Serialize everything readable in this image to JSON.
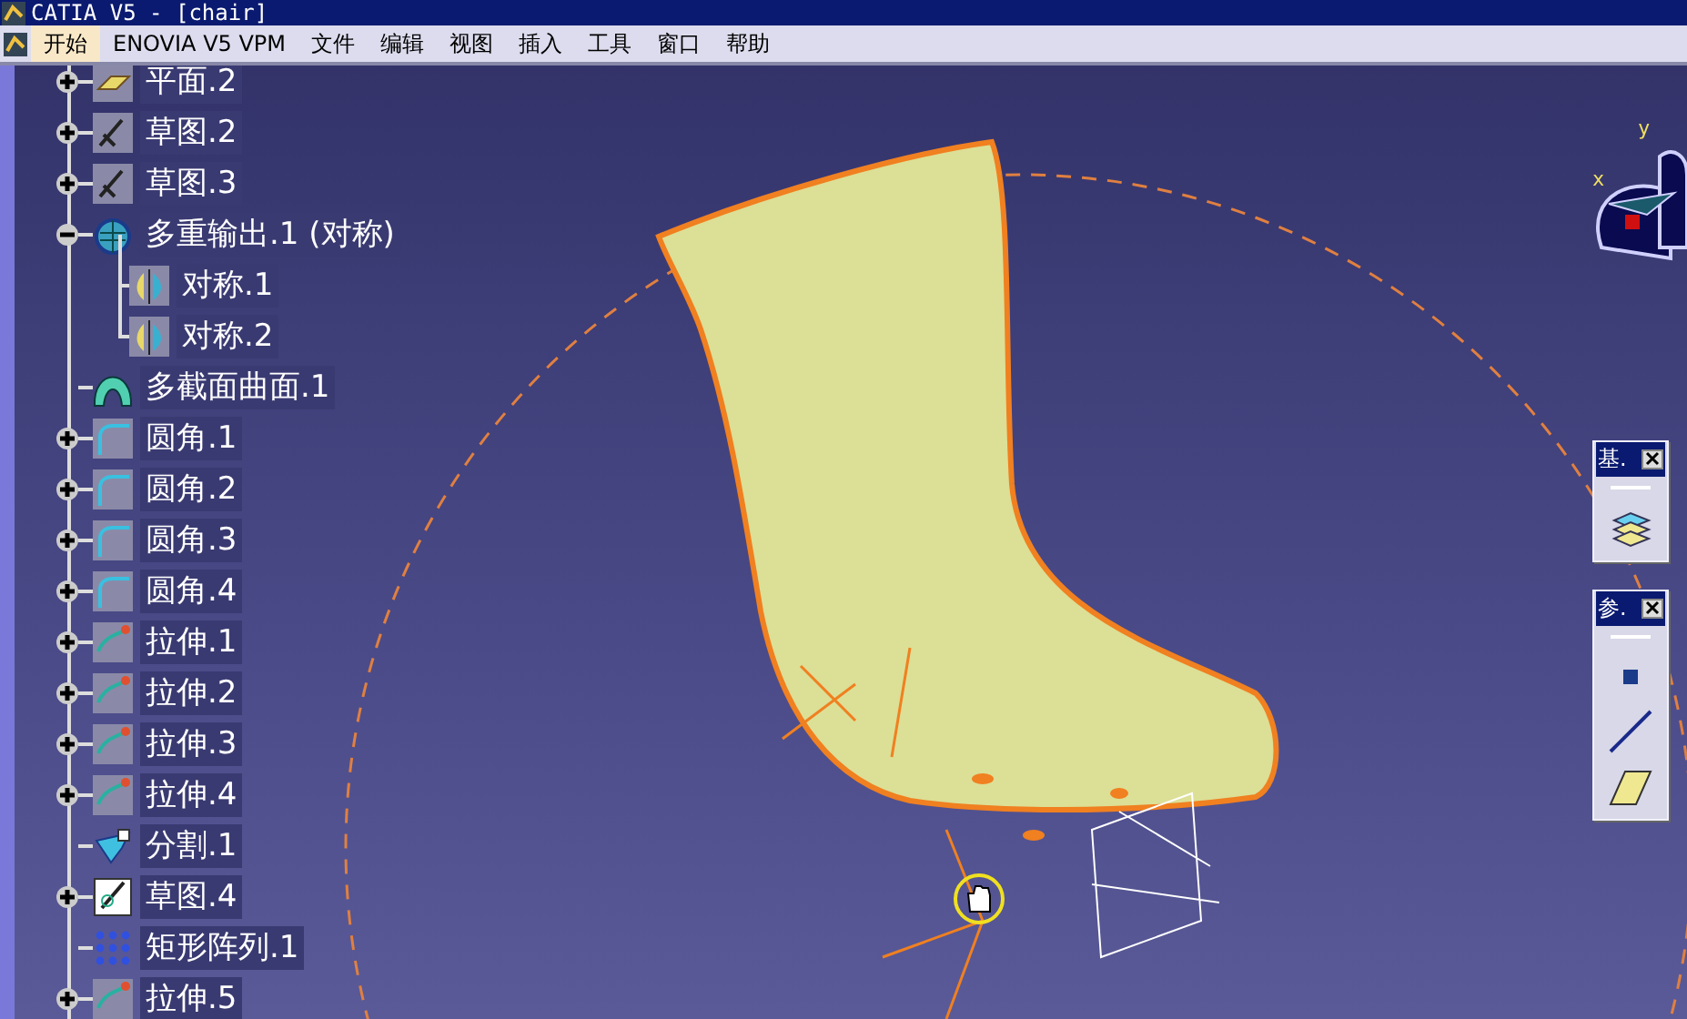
{
  "window": {
    "title": "CATIA V5 - [chair]"
  },
  "menu": [
    {
      "label": "开始",
      "selected": true
    },
    {
      "label": "ENOVIA V5 VPM",
      "selected": false
    },
    {
      "label": "文件",
      "selected": false
    },
    {
      "label": "编辑",
      "selected": false
    },
    {
      "label": "视图",
      "selected": false
    },
    {
      "label": "插入",
      "selected": false
    },
    {
      "label": "工具",
      "selected": false
    },
    {
      "label": "窗口",
      "selected": false
    },
    {
      "label": "帮助",
      "selected": false
    }
  ],
  "tree": [
    {
      "label": "平面.2",
      "kind": "plane",
      "expanded": false
    },
    {
      "label": "草图.2",
      "kind": "sketch",
      "expanded": false
    },
    {
      "label": "草图.3",
      "kind": "sketch",
      "expanded": false
    },
    {
      "label": "多重输出.1 (对称)",
      "kind": "multi",
      "expanded": true,
      "children": [
        {
          "label": "对称.1",
          "kind": "symmetry"
        },
        {
          "label": "对称.2",
          "kind": "symmetry"
        }
      ]
    },
    {
      "label": "多截面曲面.1",
      "kind": "loft"
    },
    {
      "label": "圆角.1",
      "kind": "fillet",
      "expanded": false
    },
    {
      "label": "圆角.2",
      "kind": "fillet",
      "expanded": false
    },
    {
      "label": "圆角.3",
      "kind": "fillet",
      "expanded": false
    },
    {
      "label": "圆角.4",
      "kind": "fillet",
      "expanded": false
    },
    {
      "label": "拉伸.1",
      "kind": "extrude",
      "expanded": false
    },
    {
      "label": "拉伸.2",
      "kind": "extrude",
      "expanded": false
    },
    {
      "label": "拉伸.3",
      "kind": "extrude",
      "expanded": false
    },
    {
      "label": "拉伸.4",
      "kind": "extrude",
      "expanded": false
    },
    {
      "label": "分割.1",
      "kind": "split"
    },
    {
      "label": "草图.4",
      "kind": "sketch2",
      "expanded": false
    },
    {
      "label": "矩形阵列.1",
      "kind": "pattern"
    },
    {
      "label": "拉伸.5",
      "kind": "extrude",
      "expanded": false
    }
  ],
  "compass": {
    "x_label": "x",
    "y_label": "y"
  },
  "toolbars": [
    {
      "title": "基.",
      "tools": [
        {
          "kind": "surface"
        }
      ]
    },
    {
      "title": "参.",
      "tools": [
        {
          "kind": "point"
        },
        {
          "kind": "line"
        },
        {
          "kind": "plane"
        }
      ]
    }
  ]
}
